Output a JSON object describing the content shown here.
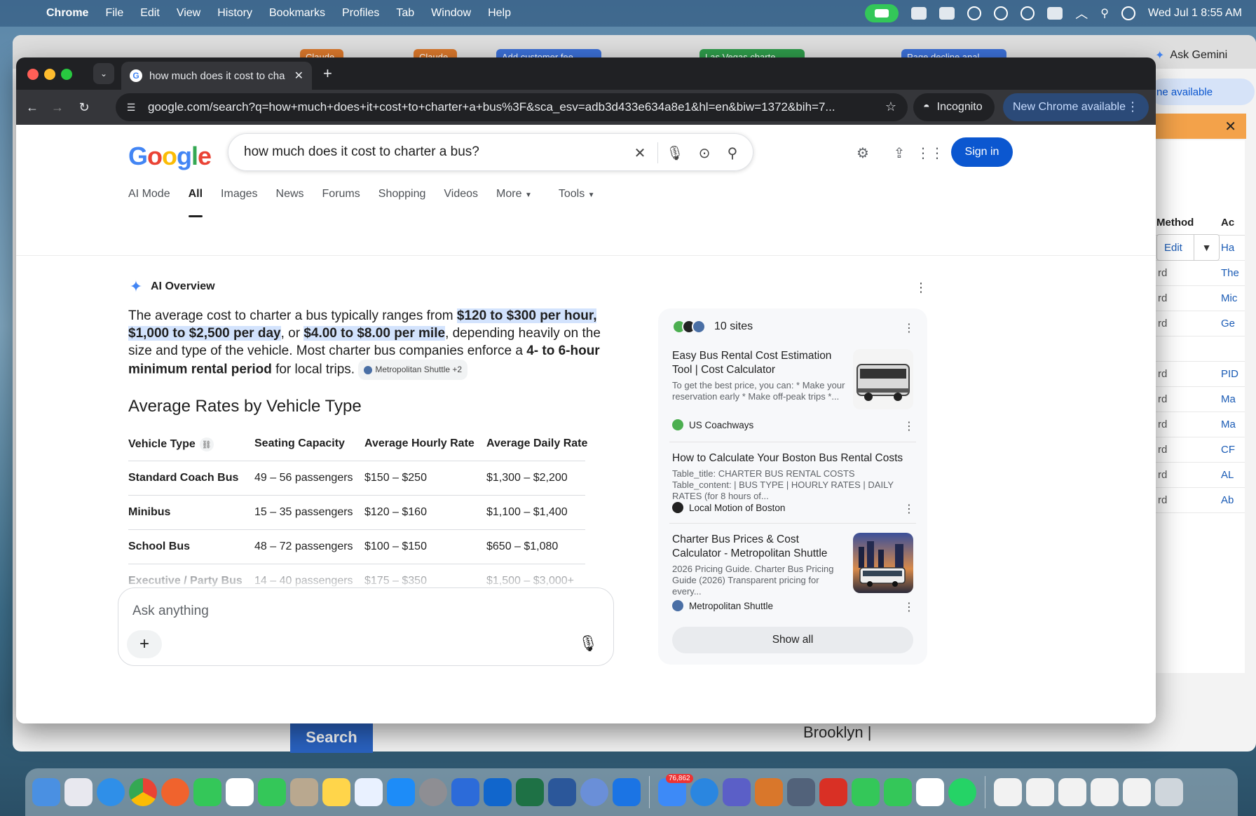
{
  "menubar": {
    "app": "Chrome",
    "items": [
      "File",
      "Edit",
      "View",
      "History",
      "Bookmarks",
      "Profiles",
      "Tab",
      "Window",
      "Help"
    ],
    "clock": "Wed Jul 1  8:55 AM"
  },
  "background": {
    "ask_gemini": "Ask Gemini",
    "avail": "ne available",
    "edit": "Edit",
    "method_header": "Method",
    "ac_header": "Ac",
    "rows": [
      {
        "a": "rd",
        "b": "Ha"
      },
      {
        "a": "rd",
        "b": "The"
      },
      {
        "a": "rd",
        "b": "Mic"
      },
      {
        "a": "rd",
        "b": "Ge"
      },
      {
        "a": "",
        "b": ""
      },
      {
        "a": "rd",
        "b": "PID"
      },
      {
        "a": "rd",
        "b": "Ma"
      },
      {
        "a": "rd",
        "b": "Ma"
      },
      {
        "a": "rd",
        "b": "CF"
      },
      {
        "a": "rd",
        "b": "AL"
      },
      {
        "a": "rd",
        "b": "Ab"
      }
    ],
    "search_button": "Search",
    "brooklyn": "Brooklyn |",
    "tabs": [
      "Claude",
      "Claude",
      "Add customer fee",
      "Las Vegas charte",
      "Page decline anal"
    ]
  },
  "browser": {
    "tab_title": "how much does it cost to cha",
    "url": "google.com/search?q=how+much+does+it+cost+to+charter+a+bus%3F&sca_esv=adb3d433e634a8e1&hl=en&biw=1372&bih=7...",
    "incognito": "Incognito",
    "new_chrome": "New Chrome available"
  },
  "google": {
    "logo": [
      "G",
      "o",
      "o",
      "g",
      "l",
      "e"
    ],
    "query": "how much does it cost to charter a bus?",
    "sign_in": "Sign in",
    "tabs": [
      "AI Mode",
      "All",
      "Images",
      "News",
      "Forums",
      "Shopping",
      "Videos",
      "More",
      "Tools"
    ],
    "active_tab": "All"
  },
  "overview": {
    "heading": "AI Overview",
    "p1": "The average cost to charter a bus typically ranges from ",
    "hl1": "$120 to $300 per hour, $1,000 to $2,500 per day",
    "p2": ", or ",
    "hl2": "$4.00 to $8.00 per mile",
    "p3": ", depending heavily on the size and type of the vehicle. Most charter bus companies enforce a ",
    "bold1": "4- to 6-hour minimum rental period",
    "p4": " for local trips.",
    "cite": "Metropolitan Shuttle +2",
    "table_title": "Average Rates by Vehicle Type",
    "columns": [
      "Vehicle Type",
      "Seating Capacity",
      "Average Hourly Rate",
      "Average Daily Rate"
    ],
    "rows": [
      [
        "Standard Coach Bus",
        "49 – 56 passengers",
        "$150 – $250",
        "$1,300 – $2,200"
      ],
      [
        "Minibus",
        "15 – 35 passengers",
        "$120 – $160",
        "$1,100 – $1,400"
      ],
      [
        "School Bus",
        "48 – 72 passengers",
        "$100 – $150",
        "$650 – $1,080"
      ],
      [
        "Executive / Party Bus",
        "14 – 40 passengers",
        "$175 – $350",
        "$1,500 – $3,000+"
      ]
    ],
    "ask_placeholder": "Ask anything"
  },
  "sources": {
    "count": "10 sites",
    "cards": [
      {
        "title": "Easy Bus Rental Cost Estimation Tool | Cost Calculator",
        "snippet": "To get the best price, you can: * Make your reservation early * Make off-peak trips *...",
        "source": "US Coachways"
      },
      {
        "title": "How to Calculate Your Boston Bus Rental Costs",
        "snippet": "Table_title: CHARTER BUS RENTAL COSTS Table_content: | BUS TYPE | HOURLY RATES | DAILY RATES (for 8 hours of...",
        "source": "Local Motion of Boston"
      },
      {
        "title": "Charter Bus Prices & Cost Calculator - Metropolitan Shuttle",
        "snippet": "2026 Pricing Guide. Charter Bus Pricing Guide (2026) Transparent pricing for every...",
        "source": "Metropolitan Shuttle"
      }
    ],
    "show_all": "Show all"
  },
  "dock": {
    "badge": "76,862"
  },
  "colors": {
    "accent": "#0b57d0",
    "highlight": "#d3e3fd"
  }
}
